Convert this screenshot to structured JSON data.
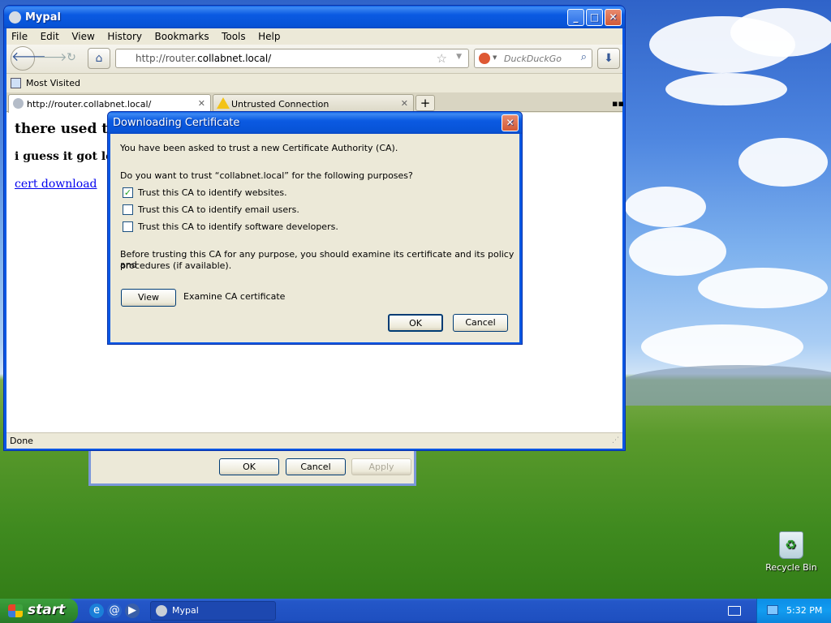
{
  "window": {
    "title": "Mypal",
    "menu": [
      "File",
      "Edit",
      "View",
      "History",
      "Bookmarks",
      "Tools",
      "Help"
    ],
    "url_prefix": "http://router.",
    "url_domain": "collabnet.local/",
    "search_placeholder": "DuckDuckGo",
    "bookmarks_label": "Most Visited",
    "tabs": [
      {
        "label": "http://router.collabnet.local/",
        "active": true
      },
      {
        "label": "Untrusted Connection",
        "active": false
      }
    ],
    "status": "Done"
  },
  "page": {
    "heading": "there used to b",
    "subheading": "i guess it got lost",
    "link": "cert download"
  },
  "background_dialog": {
    "ok": "OK",
    "cancel": "Cancel",
    "apply": "Apply"
  },
  "cert_dialog": {
    "title": "Downloading Certificate",
    "intro": "You have been asked to trust a new Certificate Authority (CA).",
    "question": "Do you want to trust “collabnet.local” for the following purposes?",
    "options": [
      {
        "label": "Trust this CA to identify websites.",
        "checked": true
      },
      {
        "label": "Trust this CA to identify email users.",
        "checked": false
      },
      {
        "label": "Trust this CA to identify software developers.",
        "checked": false
      }
    ],
    "advice_line1": "Before trusting this CA for any purpose, you should examine its certificate and its policy and",
    "advice_line2": "procedures (if available).",
    "view_button": "View",
    "view_label": "Examine CA certificate",
    "ok": "OK",
    "cancel": "Cancel"
  },
  "desktop": {
    "recycle_bin": "Recycle Bin"
  },
  "taskbar": {
    "start": "start",
    "task": "Mypal",
    "clock": "5:32 PM"
  }
}
